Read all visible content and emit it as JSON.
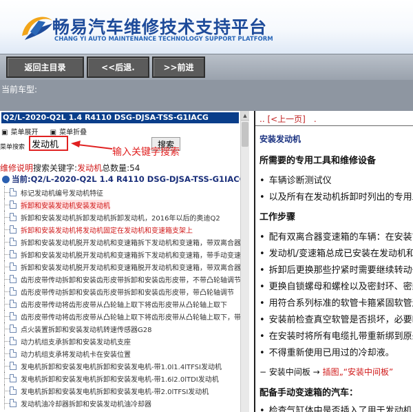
{
  "header": {
    "title_cn": "畅易汽车维修技术支持平台",
    "title_en": "CHANG YI AUTO MAINTENANCE TECHNOLOGY SUPPORT PLATFORM"
  },
  "nav": {
    "home": "返回主目录",
    "back": "<<后退.",
    "forward": ">>前进"
  },
  "model_bar": {
    "label": "当前车型:"
  },
  "left_panel": {
    "header": "Q2/L-2020-Q2L 1.4 R4110 DSG-DJSA-TSS-G1IACG",
    "expand_all": "菜单展开",
    "collapse_all": "菜单折叠",
    "search_label": "菜单搜索",
    "search_value": "发动机",
    "search_button": "搜索",
    "hint": "输入关键字搜索",
    "summary_prefix": "维修说明",
    "summary_mid": "搜索关键字:",
    "summary_keyword": "发动机",
    "summary_count_label": "总数量:",
    "summary_count": "54",
    "tree_root": "当前:Q2/L-2020-Q2L 1.4 R4110 DSG-DJSA-TSS-G1IACG",
    "items": [
      "标记发动机编号发动机特征",
      "拆卸和安装发动机安装发动机",
      "拆卸和安装发动机拆卸发动机拆卸发动机，2016年以后的奥迪Q2",
      "拆卸和安装发动机将发动机固定在发动机和变速箱支架上",
      "拆卸和安装发动机脱开发动机和变速箱拆下发动机和变速箱，带双离合器变速箱",
      "拆卸和安装发动机脱开发动机和变速箱拆下发动机和变速箱，带手动变速箱",
      "拆卸和安装发动机脱开发动机和变速箱脱开发动机和变速箱，带双离合器变速箱",
      "齿形皮带传动拆卸和安装齿形皮带拆卸和安装齿形皮带，不带凸轮轴调节",
      "齿形皮带传动拆卸和安装齿形皮带拆卸和安装齿形皮带，带凸轮轴调节",
      "齿形皮带传动将齿形皮带从凸轮轴上取下将齿形皮带从凸轮轴上取下",
      "齿形皮带传动将齿形皮带从凸轮轴上取下将齿形皮带从凸轮轴上取下，带凸轮轴调节",
      "点火装置拆卸和安装发动机转速传感器G28",
      "动力机组支承拆卸和安装发动机支座",
      "动力机组支承将发动机卡在安装位置",
      "发电机拆卸和安装发电机拆卸和安装发电机-带1.0l1.4lTFSI发动机",
      "发电机拆卸和安装发电机拆卸和安装发电机-带1.6l2.0lTDI发动机",
      "发电机拆卸和安装发电机拆卸和安装发电机-带2.0lTFSI发动机",
      "发动机油冷却器拆卸和安装发动机油冷却器"
    ]
  },
  "right_panel": {
    "prev_link": ".. [<上一页]　.",
    "section_title": "安装发动机",
    "tools_heading": "所需要的专用工具和维修设备",
    "tools": [
      "车辆诊断测试仪",
      "以及所有在发动机拆卸时列出的专用工具"
    ],
    "steps_heading": "工作步骤",
    "steps": [
      "配有双离合器变速箱的车辆：在安装前检查",
      "发动机/变速箱总成已安装在发动机和变速箱支架上",
      "拆卸后更换那些拧紧时需要继续转动一定角度的螺栓",
      "更换自锁螺母和螺栓以及密封环、密封件",
      "用符合系列标准的软管卡箍紧固软管连接",
      "安装前检查真空软管是否损坏，必要时更换",
      "在安装时将所有电缆扎带重新绑到原来位置",
      "不得重新使用已用过的冷却液。"
    ],
    "middle_plate_prefix": "− 安装中间板 →",
    "middle_plate_link": "插图„“安装中间板”",
    "manual_heading": "配备手动变速箱的汽车：",
    "manual_first": "检查气缸体中是否插入了用于发动机"
  }
}
